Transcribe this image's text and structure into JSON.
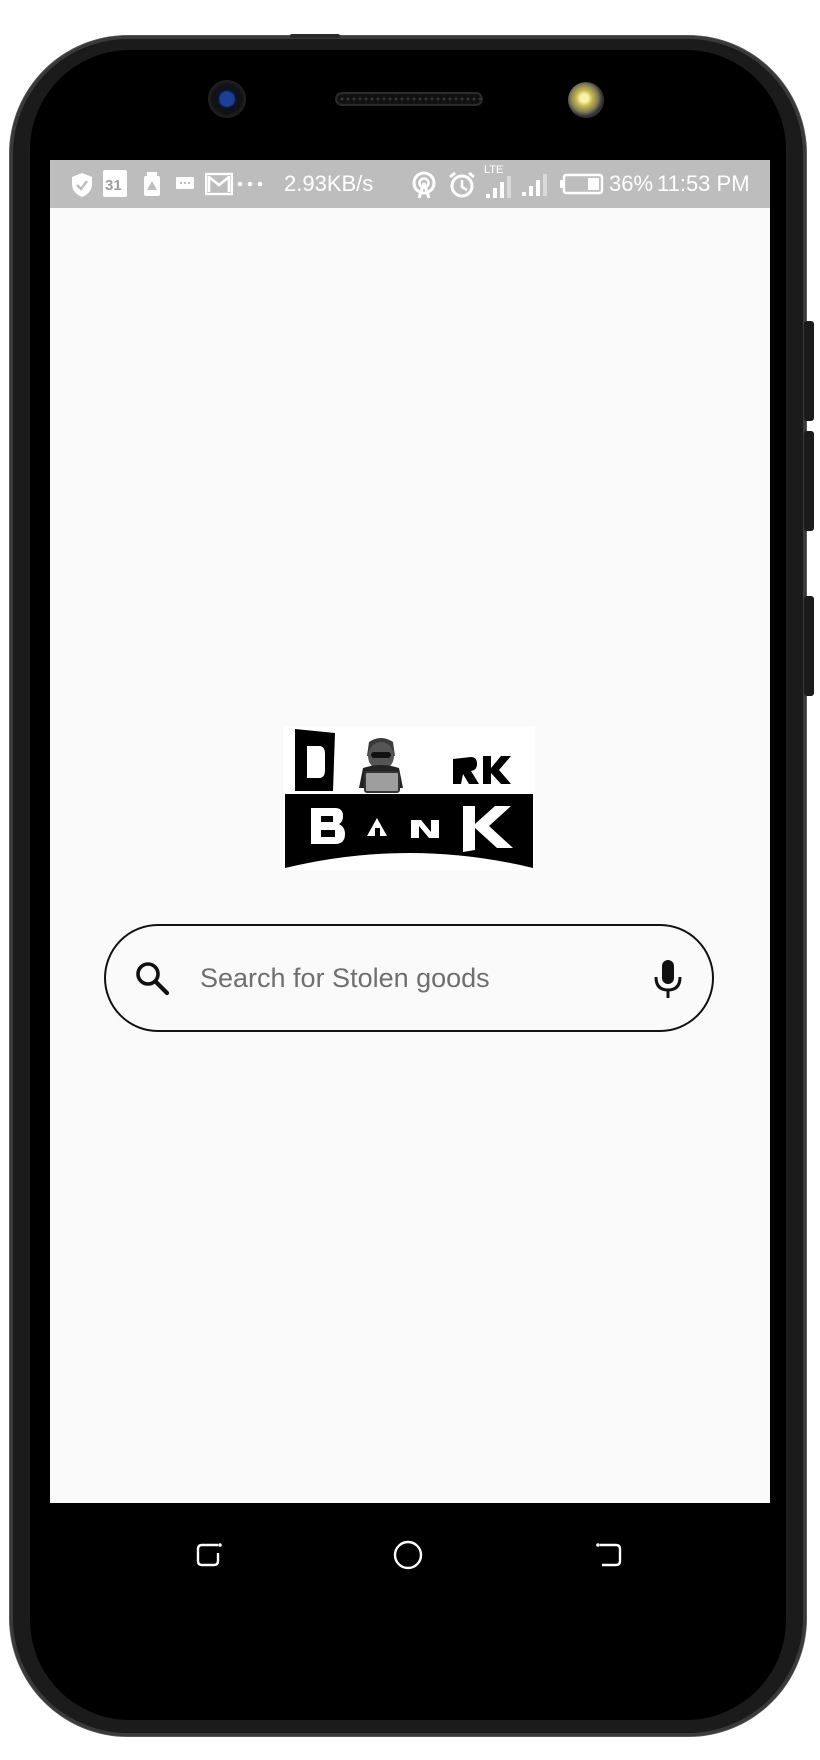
{
  "status_bar": {
    "network_speed": "2.93KB/s",
    "lte_label": "LTE",
    "battery_percent": "36%",
    "time": "11:53 PM",
    "calendar_day": "31",
    "icons": [
      "shield-icon",
      "calendar-icon",
      "drive-icon",
      "message-icon",
      "gmail-icon",
      "more-dots-icon",
      "hotspot-icon",
      "alarm-icon",
      "lte-signal-icon",
      "signal-icon",
      "battery-icon"
    ]
  },
  "logo": {
    "line1": [
      "D",
      "RK"
    ],
    "line2": "BANK"
  },
  "search": {
    "placeholder": "Search for Stolen goods",
    "value": ""
  },
  "nav_bar": {
    "icons": [
      "recent-apps-icon",
      "home-icon",
      "back-icon"
    ]
  },
  "colors": {
    "status_bar": "#bdbdbd",
    "screen_background": "#fafafa",
    "search_border": "#111111",
    "phone_body": "#1b1b1b"
  }
}
